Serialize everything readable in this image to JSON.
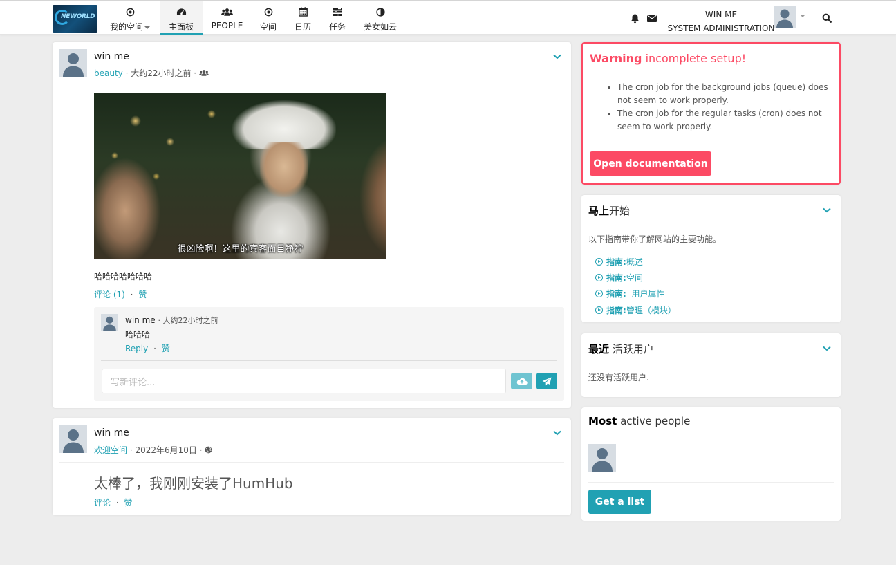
{
  "colors": {
    "accent": "#21a1b3",
    "danger": "#fc4a64",
    "background": "#ededed"
  },
  "nav": {
    "items": [
      {
        "label": "我的空间",
        "icon": "dot-circle-icon",
        "has_caret": true
      },
      {
        "label": "主面板",
        "icon": "dashboard-icon",
        "active": true
      },
      {
        "label": "PEOPLE",
        "icon": "users-icon"
      },
      {
        "label": "空间",
        "icon": "dot-circle-icon"
      },
      {
        "label": "日历",
        "icon": "calendar-icon"
      },
      {
        "label": "任务",
        "icon": "tasks-icon"
      },
      {
        "label": "美女如云",
        "icon": "adjust-icon"
      }
    ]
  },
  "user": {
    "name": "WIN ME",
    "role": "SYSTEM ADMINISTRATION"
  },
  "post1": {
    "author": "win me",
    "space": "beauty",
    "time": "· 大约22小时之前 ·",
    "image_subtitle": "很凶险啊！这里的宾客面目狰狞",
    "text": "哈哈哈哈哈哈哈",
    "comment_link": "评论 (1)",
    "sep": "·",
    "like": "赞",
    "comment": {
      "author": "win me",
      "time": "· 大约22小时之前",
      "text": "哈哈哈",
      "reply": "Reply",
      "like": "赞"
    },
    "new_comment_placeholder": "写新评论..."
  },
  "post2": {
    "author": "win me",
    "space": "欢迎空间",
    "time": "· 2022年6月10日 ·",
    "text": "太棒了，我刚刚安装了HumHub",
    "comment_link": "评论",
    "sep": "·",
    "like": "赞"
  },
  "warning": {
    "title_bold": "Warning",
    "title_rest": " incomplete setup!",
    "items": [
      "The cron job for the background jobs (queue) does not seem to work properly.",
      "The cron job for the regular tasks (cron) does not seem to work properly."
    ],
    "button": "Open documentation"
  },
  "getting_started": {
    "title_bold": "马上",
    "title_rest": "开始",
    "intro": "以下指南带你了解网站的主要功能。",
    "guides": [
      {
        "bold": "指南:",
        "label": " 概述"
      },
      {
        "bold": "指南:",
        "label": " 空间"
      },
      {
        "bold": "指南:",
        "label": "  用户属性"
      },
      {
        "bold": "指南:",
        "label": " 管理（模块）"
      }
    ]
  },
  "recent_users": {
    "title_bold": "最近",
    "title_rest": " 活跃用户",
    "empty": "还没有活跃用户."
  },
  "most_active": {
    "title_bold": "Most",
    "title_rest": " active people",
    "button": "Get a list"
  }
}
